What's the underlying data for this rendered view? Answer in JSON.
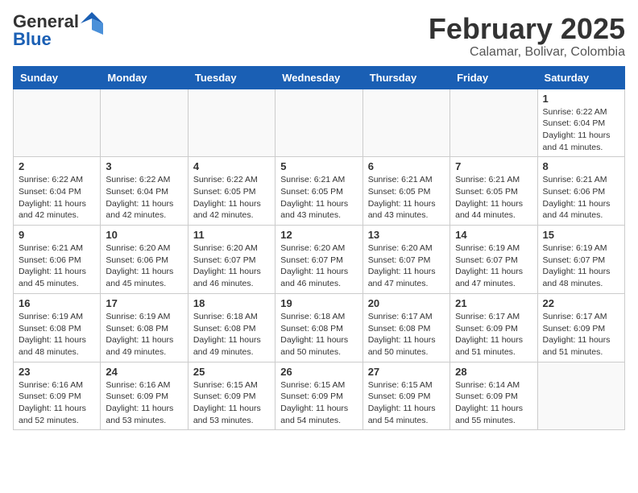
{
  "header": {
    "logo_general": "General",
    "logo_blue": "Blue",
    "month_title": "February 2025",
    "location": "Calamar, Bolivar, Colombia"
  },
  "weekdays": [
    "Sunday",
    "Monday",
    "Tuesday",
    "Wednesday",
    "Thursday",
    "Friday",
    "Saturday"
  ],
  "weeks": [
    [
      {
        "day": null,
        "info": null
      },
      {
        "day": null,
        "info": null
      },
      {
        "day": null,
        "info": null
      },
      {
        "day": null,
        "info": null
      },
      {
        "day": null,
        "info": null
      },
      {
        "day": null,
        "info": null
      },
      {
        "day": "1",
        "info": "Sunrise: 6:22 AM\nSunset: 6:04 PM\nDaylight: 11 hours and 41 minutes."
      }
    ],
    [
      {
        "day": "2",
        "info": "Sunrise: 6:22 AM\nSunset: 6:04 PM\nDaylight: 11 hours and 42 minutes."
      },
      {
        "day": "3",
        "info": "Sunrise: 6:22 AM\nSunset: 6:04 PM\nDaylight: 11 hours and 42 minutes."
      },
      {
        "day": "4",
        "info": "Sunrise: 6:22 AM\nSunset: 6:05 PM\nDaylight: 11 hours and 42 minutes."
      },
      {
        "day": "5",
        "info": "Sunrise: 6:21 AM\nSunset: 6:05 PM\nDaylight: 11 hours and 43 minutes."
      },
      {
        "day": "6",
        "info": "Sunrise: 6:21 AM\nSunset: 6:05 PM\nDaylight: 11 hours and 43 minutes."
      },
      {
        "day": "7",
        "info": "Sunrise: 6:21 AM\nSunset: 6:05 PM\nDaylight: 11 hours and 44 minutes."
      },
      {
        "day": "8",
        "info": "Sunrise: 6:21 AM\nSunset: 6:06 PM\nDaylight: 11 hours and 44 minutes."
      }
    ],
    [
      {
        "day": "9",
        "info": "Sunrise: 6:21 AM\nSunset: 6:06 PM\nDaylight: 11 hours and 45 minutes."
      },
      {
        "day": "10",
        "info": "Sunrise: 6:20 AM\nSunset: 6:06 PM\nDaylight: 11 hours and 45 minutes."
      },
      {
        "day": "11",
        "info": "Sunrise: 6:20 AM\nSunset: 6:07 PM\nDaylight: 11 hours and 46 minutes."
      },
      {
        "day": "12",
        "info": "Sunrise: 6:20 AM\nSunset: 6:07 PM\nDaylight: 11 hours and 46 minutes."
      },
      {
        "day": "13",
        "info": "Sunrise: 6:20 AM\nSunset: 6:07 PM\nDaylight: 11 hours and 47 minutes."
      },
      {
        "day": "14",
        "info": "Sunrise: 6:19 AM\nSunset: 6:07 PM\nDaylight: 11 hours and 47 minutes."
      },
      {
        "day": "15",
        "info": "Sunrise: 6:19 AM\nSunset: 6:07 PM\nDaylight: 11 hours and 48 minutes."
      }
    ],
    [
      {
        "day": "16",
        "info": "Sunrise: 6:19 AM\nSunset: 6:08 PM\nDaylight: 11 hours and 48 minutes."
      },
      {
        "day": "17",
        "info": "Sunrise: 6:19 AM\nSunset: 6:08 PM\nDaylight: 11 hours and 49 minutes."
      },
      {
        "day": "18",
        "info": "Sunrise: 6:18 AM\nSunset: 6:08 PM\nDaylight: 11 hours and 49 minutes."
      },
      {
        "day": "19",
        "info": "Sunrise: 6:18 AM\nSunset: 6:08 PM\nDaylight: 11 hours and 50 minutes."
      },
      {
        "day": "20",
        "info": "Sunrise: 6:17 AM\nSunset: 6:08 PM\nDaylight: 11 hours and 50 minutes."
      },
      {
        "day": "21",
        "info": "Sunrise: 6:17 AM\nSunset: 6:09 PM\nDaylight: 11 hours and 51 minutes."
      },
      {
        "day": "22",
        "info": "Sunrise: 6:17 AM\nSunset: 6:09 PM\nDaylight: 11 hours and 51 minutes."
      }
    ],
    [
      {
        "day": "23",
        "info": "Sunrise: 6:16 AM\nSunset: 6:09 PM\nDaylight: 11 hours and 52 minutes."
      },
      {
        "day": "24",
        "info": "Sunrise: 6:16 AM\nSunset: 6:09 PM\nDaylight: 11 hours and 53 minutes."
      },
      {
        "day": "25",
        "info": "Sunrise: 6:15 AM\nSunset: 6:09 PM\nDaylight: 11 hours and 53 minutes."
      },
      {
        "day": "26",
        "info": "Sunrise: 6:15 AM\nSunset: 6:09 PM\nDaylight: 11 hours and 54 minutes."
      },
      {
        "day": "27",
        "info": "Sunrise: 6:15 AM\nSunset: 6:09 PM\nDaylight: 11 hours and 54 minutes."
      },
      {
        "day": "28",
        "info": "Sunrise: 6:14 AM\nSunset: 6:09 PM\nDaylight: 11 hours and 55 minutes."
      },
      {
        "day": null,
        "info": null
      }
    ]
  ]
}
